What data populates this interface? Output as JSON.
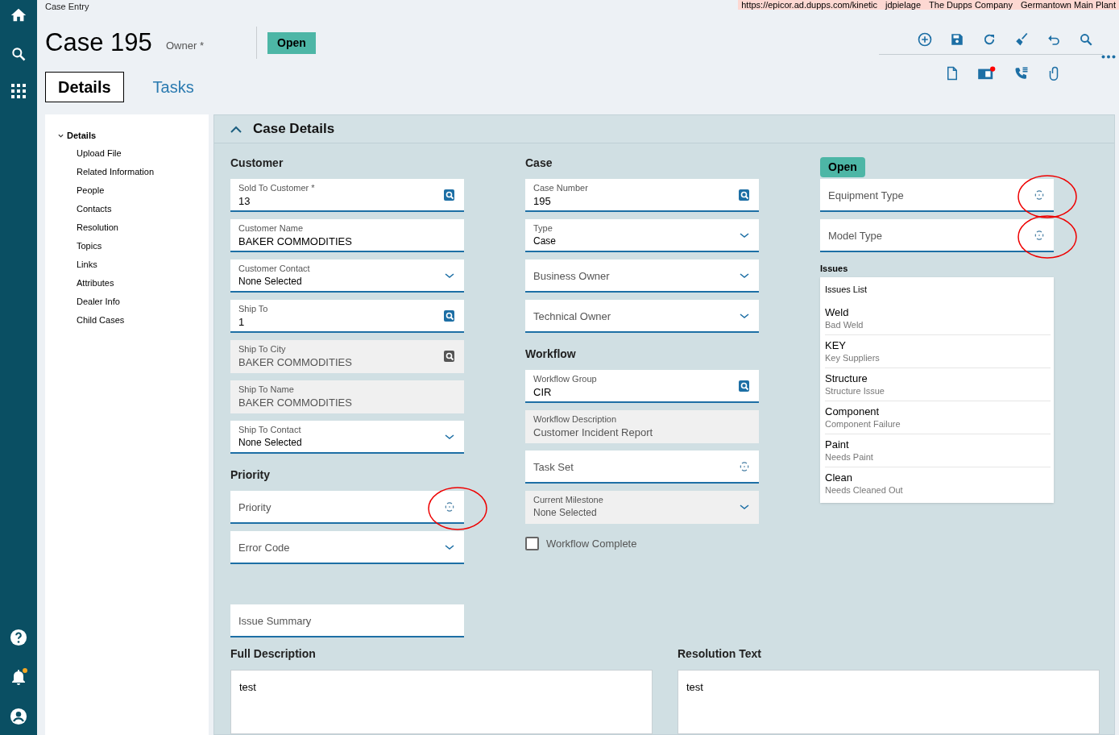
{
  "breadcrumb": "Case Entry",
  "env_bar": [
    "https://epicor.ad.dupps.com/kinetic",
    "jdpielage",
    "The Dupps Company",
    "Germantown Main Plant"
  ],
  "title": "Case 195",
  "owner_label": "Owner *",
  "status": "Open",
  "tabs": [
    {
      "label": "Details",
      "selected": true
    },
    {
      "label": "Tasks",
      "selected": false
    }
  ],
  "tree": {
    "label": "Details",
    "expanded": true,
    "children": [
      {
        "label": "Upload File"
      },
      {
        "label": "Related Information"
      },
      {
        "label": "People"
      },
      {
        "label": "Contacts"
      },
      {
        "label": "Resolution"
      },
      {
        "label": "Topics"
      },
      {
        "label": "Links"
      },
      {
        "label": "Attributes"
      },
      {
        "label": "Dealer Info"
      },
      {
        "label": "Child Cases"
      }
    ]
  },
  "panel_title": "Case Details",
  "columns": [
    {
      "sections": [
        {
          "heading": "Customer",
          "fields": [
            {
              "label": "Sold To Customer *",
              "value": "13",
              "kind": "search",
              "readonly": false
            },
            {
              "label": "Customer Name",
              "value": "BAKER COMMODITIES",
              "kind": "text",
              "readonly": false
            },
            {
              "label": "Customer Contact",
              "value": "None Selected",
              "kind": "dropdown",
              "readonly": false
            },
            {
              "label": "Ship To",
              "value": "1",
              "kind": "search",
              "readonly": false
            },
            {
              "label": "Ship To City",
              "value": "BAKER COMMODITIES",
              "kind": "search",
              "readonly": true
            },
            {
              "label": "Ship To Name",
              "value": "BAKER COMMODITIES",
              "kind": "text",
              "readonly": true
            },
            {
              "label": "Ship To Contact",
              "value": "None Selected",
              "kind": "dropdown",
              "readonly": false
            }
          ]
        },
        {
          "heading": "Priority",
          "fields": [
            {
              "label": "Priority",
              "kind": "spinner",
              "readonly": false,
              "annotated": true
            },
            {
              "label": "Error Code",
              "kind": "dropdown",
              "readonly": false
            }
          ]
        }
      ]
    },
    {
      "sections": [
        {
          "heading": "Case",
          "fields": [
            {
              "label": "Case Number",
              "value": "195",
              "kind": "search",
              "readonly": false
            },
            {
              "label": "Type",
              "value": "Case",
              "kind": "dropdown",
              "readonly": false
            },
            {
              "label": "Business Owner",
              "kind": "dropdown",
              "readonly": false
            },
            {
              "label": "Technical Owner",
              "kind": "dropdown",
              "readonly": false
            }
          ]
        },
        {
          "heading": "Workflow",
          "fields": [
            {
              "label": "Workflow Group",
              "value": "CIR",
              "kind": "search",
              "readonly": false
            },
            {
              "label": "Workflow Description",
              "value": "Customer Incident Report",
              "kind": "text",
              "readonly": true
            },
            {
              "label": "Task Set",
              "kind": "spinner",
              "readonly": false
            },
            {
              "label": "Current Milestone",
              "value": "None Selected",
              "kind": "dropdown",
              "readonly": true
            }
          ]
        }
      ],
      "checkbox": {
        "label": "Workflow Complete",
        "checked": false
      }
    },
    {
      "badge": "Open",
      "sections": [
        {
          "fields": [
            {
              "label": "Equipment Type",
              "kind": "spinner",
              "readonly": false,
              "annotated": true
            },
            {
              "label": "Model Type",
              "kind": "spinner",
              "readonly": false,
              "annotated": true
            }
          ]
        }
      ],
      "issues": {
        "heading": "Issues",
        "list_title": "Issues List",
        "items": [
          {
            "title": "Weld",
            "subtitle": "Bad Weld"
          },
          {
            "title": "KEY",
            "subtitle": "Key Suppliers"
          },
          {
            "title": "Structure",
            "subtitle": "Structure Issue"
          },
          {
            "title": "Component",
            "subtitle": "Component Failure"
          },
          {
            "title": "Paint",
            "subtitle": "Needs Paint"
          },
          {
            "title": "Clean",
            "subtitle": "Needs Cleaned Out"
          }
        ]
      }
    }
  ],
  "issue_summary": {
    "label": "Issue Summary"
  },
  "text_areas": [
    {
      "heading": "Full Description",
      "value": "test"
    },
    {
      "heading": "Resolution Text",
      "value": "test"
    }
  ]
}
